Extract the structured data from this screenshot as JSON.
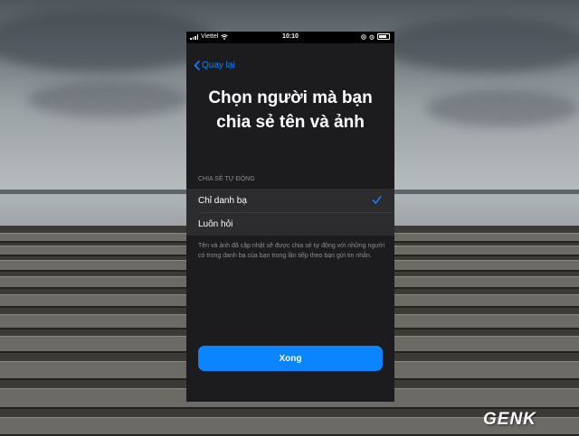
{
  "status_bar": {
    "carrier": "Viettel",
    "time": "10:10"
  },
  "nav": {
    "back_label": "Quay lại"
  },
  "title": {
    "line1": "Chọn người mà bạn",
    "line2": "chia sẻ tên và ảnh"
  },
  "section": {
    "header": "CHIA SẺ TỰ ĐỘNG"
  },
  "options": [
    {
      "label": "Chỉ danh bạ",
      "selected": true
    },
    {
      "label": "Luôn hỏi",
      "selected": false
    }
  ],
  "footer_text": "Tên và ảnh đã cập nhật sẽ được chia sẻ tự động với những người có trong danh bạ của bạn trong lần tiếp theo bạn gửi tin nhắn.",
  "done_button": {
    "label": "Xong"
  },
  "watermark": "GENK",
  "colors": {
    "accent": "#0a84ff",
    "background": "#1c1c1e",
    "cell": "#2c2c2e"
  }
}
